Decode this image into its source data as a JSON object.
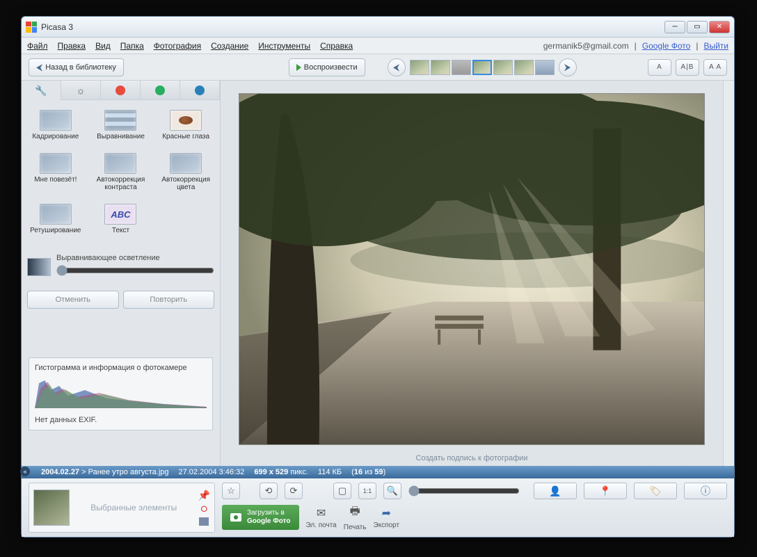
{
  "window": {
    "title": "Picasa 3"
  },
  "menu": {
    "items": [
      "Файл",
      "Правка",
      "Вид",
      "Папка",
      "Фотография",
      "Создание",
      "Инструменты",
      "Справка"
    ],
    "user_email": "germanik5@gmail.com",
    "google_photos": "Google Фото",
    "logout": "Выйти"
  },
  "toolbar": {
    "back_label": "Назад в библиотеку",
    "play_label": "Воспроизвести"
  },
  "view_buttons": [
    "A",
    "A|B",
    "A A"
  ],
  "sidebar": {
    "tools": [
      "Кадрирование",
      "Выравнивание",
      "Красные глаза",
      "Мне повезёт!",
      "Автокоррекция контраста",
      "Автокоррекция цвета",
      "Ретуширование",
      "Текст"
    ],
    "fill_light_label": "Выравнивающее осветление",
    "undo": "Отменить",
    "redo": "Повторить",
    "histo_label": "Гистограмма и информация о фотокамере",
    "histo_note": "Нет данных EXIF."
  },
  "viewer": {
    "caption_placeholder": "Создать подпись к фотографии"
  },
  "infobar": {
    "folder": "2004.02.27",
    "filename": "Ранее утро августа.jpg",
    "datetime": "27.02.2004 3:46:32",
    "dimensions": "699 x 529",
    "px_label": "пикс.",
    "filesize": "114 КБ",
    "pos_current": "16",
    "pos_of": "из",
    "pos_total": "59"
  },
  "bottom": {
    "selection_label": "Выбранные элементы",
    "upload_line1": "Загрузить в",
    "upload_line2": "Google Фото",
    "email": "Эл. почта",
    "print": "Печать",
    "export": "Экспорт"
  }
}
